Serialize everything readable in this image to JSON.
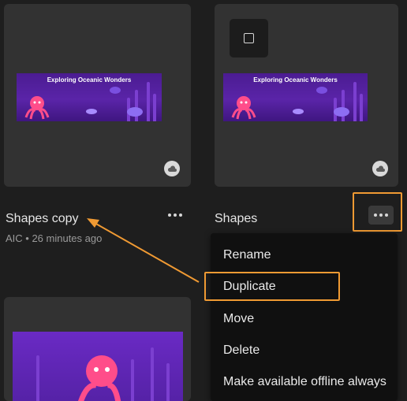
{
  "cards": [
    {
      "title": "Shapes copy",
      "meta": "AIC • 26 minutes ago",
      "thumbnail_text": "Exploring Oceanic Wonders",
      "badge_icon": "cloud-icon"
    },
    {
      "title": "Shapes",
      "thumbnail_text": "Exploring Oceanic Wonders",
      "badge_icon": "cloud-icon"
    }
  ],
  "context_menu": {
    "items": [
      "Rename",
      "Duplicate",
      "Move",
      "Delete",
      "Make available offline always"
    ],
    "highlighted": "Duplicate"
  },
  "annotation_color": "#f09a33",
  "icons": {
    "more": "more-horizontal-icon",
    "select": "checkbox-icon",
    "cloud": "cloud-icon"
  }
}
